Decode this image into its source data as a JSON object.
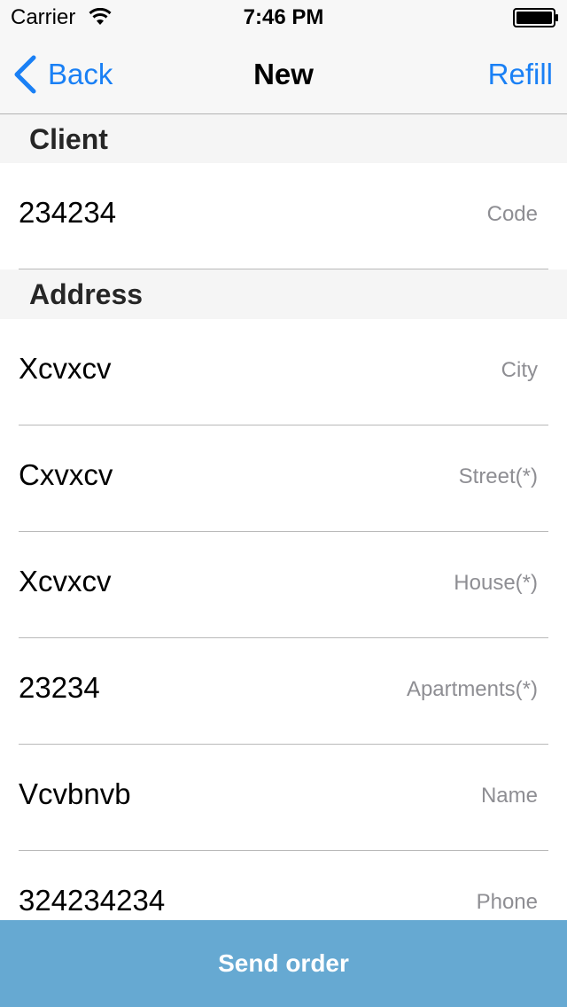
{
  "status_bar": {
    "carrier": "Carrier",
    "time": "7:46 PM",
    "wifi_icon": "wifi-icon",
    "battery_icon": "battery-icon"
  },
  "nav": {
    "back_label": "Back",
    "title": "New",
    "refill_label": "Refill",
    "accent_color": "#1a80f5"
  },
  "sections": {
    "client": {
      "title": "Client",
      "fields": [
        {
          "value": "234234",
          "label": "Code"
        }
      ]
    },
    "address": {
      "title": "Address",
      "fields": [
        {
          "value": "Xcvxcv",
          "label": "City"
        },
        {
          "value": "Cxvxcv",
          "label": "Street(*)"
        },
        {
          "value": "Xcvxcv",
          "label": "House(*)"
        },
        {
          "value": "23234",
          "label": "Apartments(*)"
        },
        {
          "value": "Vcvbnvb",
          "label": "Name"
        },
        {
          "value": "324234234",
          "label": "Phone"
        }
      ]
    }
  },
  "footer": {
    "send_label": "Send order",
    "button_color": "#66a9d2"
  }
}
